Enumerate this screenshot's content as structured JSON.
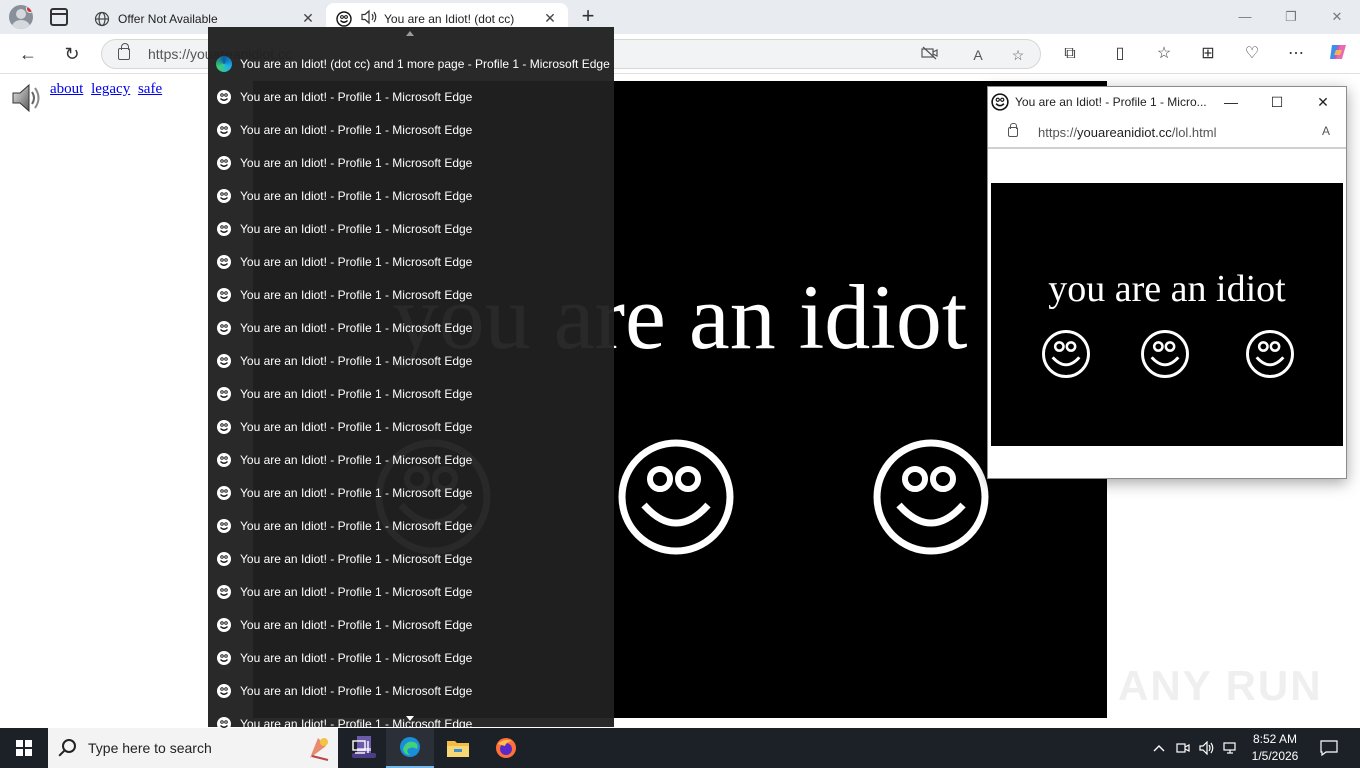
{
  "browser": {
    "tabs": [
      {
        "title": "Offer Not Available",
        "favicon": "globe-icon",
        "close_glyph": "✕"
      },
      {
        "title": "You are an Idiot! (dot cc)",
        "favicon": "smiley-icon",
        "audio_icon": "speaker-icon",
        "close_glyph": "✕",
        "active": true
      }
    ],
    "new_tab_glyph": "+",
    "window_controls": {
      "minimize": "—",
      "restore": "❐",
      "close": "✕"
    },
    "address": {
      "url": "https://youareanidiot.cc"
    },
    "nav": {
      "back": "←",
      "reload": "↻"
    },
    "toolbar_icons": [
      "camera-off-icon",
      "read-aloud-icon",
      "favorite-star-icon",
      "extensions-icon",
      "split-screen-icon",
      "favorites-icon",
      "collections-icon",
      "performance-icon",
      "more-icon",
      "copilot-icon"
    ]
  },
  "page": {
    "links": [
      "about",
      "legacy",
      "safe"
    ],
    "headline": "you are an idiot",
    "smiley_count": 3
  },
  "popup": {
    "title": "You are an Idiot! - Profile 1 - Micro...",
    "url_prefix": "https://",
    "url_domain": "youareanidiot.cc",
    "url_path": "/lol.html",
    "headline": "you are an idiot",
    "controls": {
      "minimize": "—",
      "maximize": "☐",
      "close": "✕"
    }
  },
  "thumbnail_list": {
    "header": "You are an Idiot! (dot cc) and 1 more page - Profile 1 - Microsoft Edge",
    "items": [
      "You are an Idiot! - Profile 1 - Microsoft Edge",
      "You are an Idiot! - Profile 1 - Microsoft Edge",
      "You are an Idiot! - Profile 1 - Microsoft Edge",
      "You are an Idiot! - Profile 1 - Microsoft Edge",
      "You are an Idiot! - Profile 1 - Microsoft Edge",
      "You are an Idiot! - Profile 1 - Microsoft Edge",
      "You are an Idiot! - Profile 1 - Microsoft Edge",
      "You are an Idiot! - Profile 1 - Microsoft Edge",
      "You are an Idiot! - Profile 1 - Microsoft Edge",
      "You are an Idiot! - Profile 1 - Microsoft Edge",
      "You are an Idiot! - Profile 1 - Microsoft Edge",
      "You are an Idiot! - Profile 1 - Microsoft Edge",
      "You are an Idiot! - Profile 1 - Microsoft Edge",
      "You are an Idiot! - Profile 1 - Microsoft Edge",
      "You are an Idiot! - Profile 1 - Microsoft Edge",
      "You are an Idiot! - Profile 1 - Microsoft Edge",
      "You are an Idiot! - Profile 1 - Microsoft Edge",
      "You are an Idiot! - Profile 1 - Microsoft Edge",
      "You are an Idiot! - Profile 1 - Microsoft Edge",
      "You are an Idiot! - Profile 1 - Microsoft Edge"
    ]
  },
  "taskbar": {
    "search_placeholder": "Type here to search",
    "time": "8:52 AM",
    "date": "1/5/2026",
    "pinned": [
      "task-view-icon",
      "edge-icon",
      "file-explorer-icon",
      "firefox-icon"
    ],
    "tray_icons": [
      "chevron-up-icon",
      "meet-now-icon",
      "volume-icon",
      "network-icon",
      "notifications-icon"
    ]
  },
  "watermark": "ANY RUN",
  "colors": {
    "titlebar": "#e8ebef",
    "stage_bg": "#000000",
    "thumbs_bg": "#202020",
    "taskbar_bg": "#1c2027",
    "link": "#0000ee"
  }
}
